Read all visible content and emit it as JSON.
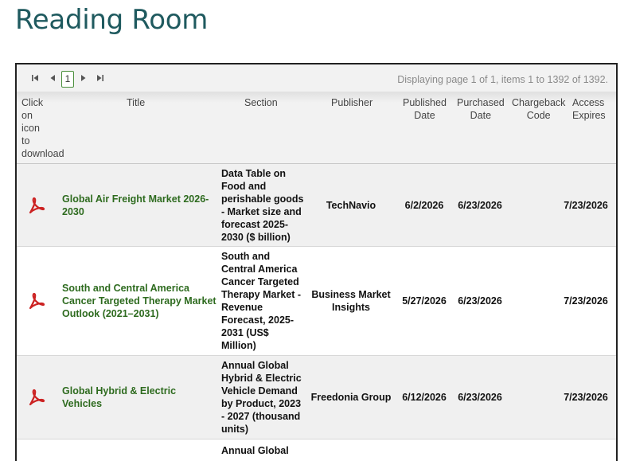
{
  "page": {
    "title": "Reading Room"
  },
  "pager": {
    "first_icon": "first-page-icon",
    "prev_icon": "prev-page-icon",
    "next_icon": "next-page-icon",
    "last_icon": "last-page-icon",
    "current_page": "1",
    "info": "Displaying page 1 of 1, items 1 to 1392 of 1392."
  },
  "columns": {
    "download": [
      "Click",
      "on",
      "icon",
      "to",
      "download"
    ],
    "title": "Title",
    "section": "Section",
    "publisher": "Publisher",
    "published": [
      "Published",
      "Date"
    ],
    "purchased": [
      "Purchased",
      "Date"
    ],
    "chargeback": [
      "Chargeback",
      "Code"
    ],
    "expires": [
      "Access",
      "Expires"
    ]
  },
  "rows": [
    {
      "title_lines": [
        "Global Air Freight Market 2026-",
        "2030"
      ],
      "section_lines": [
        "Data Table on",
        "Food and",
        "perishable goods",
        "- Market size and",
        "forecast 2025-",
        "2030 ($ billion)"
      ],
      "publisher_lines": [
        "TechNavio"
      ],
      "published": "6/2/2026",
      "purchased": "6/23/2026",
      "chargeback": "",
      "expires": "7/23/2026"
    },
    {
      "title_lines": [
        "South and Central America",
        "Cancer Targeted Therapy Market",
        "Outlook (2021–2031)"
      ],
      "section_lines": [
        "South and",
        "Central America",
        "Cancer Targeted",
        "Therapy Market -",
        "Revenue",
        "Forecast, 2025-",
        "2031 (US$",
        "Million)"
      ],
      "publisher_lines": [
        "Business Market",
        "Insights"
      ],
      "published": "5/27/2026",
      "purchased": "6/23/2026",
      "chargeback": "",
      "expires": "7/23/2026"
    },
    {
      "title_lines": [
        "Global Hybrid & Electric Vehicles"
      ],
      "section_lines": [
        "Annual Global",
        "Hybrid & Electric",
        "Vehicle Demand",
        "by Product, 2023",
        "- 2027 (thousand",
        "units)"
      ],
      "publisher_lines": [
        "Freedonia Group"
      ],
      "published": "6/12/2026",
      "purchased": "6/23/2026",
      "chargeback": "",
      "expires": "7/23/2026"
    },
    {
      "title_lines": [
        ""
      ],
      "section_lines": [
        "Annual Global"
      ],
      "publisher_lines": [
        ""
      ],
      "published": "",
      "purchased": "",
      "chargeback": "",
      "expires": ""
    }
  ],
  "icons": {
    "download": "pdf-download-icon"
  }
}
